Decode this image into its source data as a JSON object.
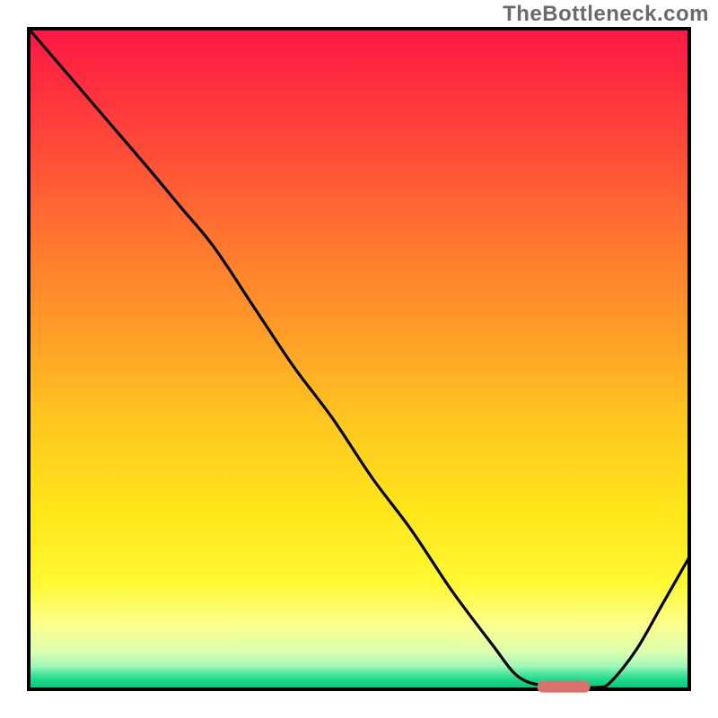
{
  "watermark": "TheBottleneck.com",
  "chart_data": {
    "type": "line",
    "title": "",
    "xlabel": "",
    "ylabel": "",
    "xlim": [
      0,
      100
    ],
    "ylim": [
      0,
      100
    ],
    "background": {
      "gradient_stops": [
        {
          "offset": 0.0,
          "color": "#ff1744"
        },
        {
          "offset": 0.07,
          "color": "#ff2a3f"
        },
        {
          "offset": 0.18,
          "color": "#ff4a38"
        },
        {
          "offset": 0.3,
          "color": "#ff7030"
        },
        {
          "offset": 0.45,
          "color": "#ff9a28"
        },
        {
          "offset": 0.6,
          "color": "#ffc81f"
        },
        {
          "offset": 0.73,
          "color": "#ffe61a"
        },
        {
          "offset": 0.84,
          "color": "#fff833"
        },
        {
          "offset": 0.9,
          "color": "#fdff8a"
        },
        {
          "offset": 0.945,
          "color": "#d8ffb0"
        },
        {
          "offset": 0.965,
          "color": "#a0f7b8"
        },
        {
          "offset": 0.975,
          "color": "#58e8a0"
        },
        {
          "offset": 0.985,
          "color": "#20d98a"
        },
        {
          "offset": 1.0,
          "color": "#00c776"
        }
      ]
    },
    "series": [
      {
        "name": "bottleneck-curve",
        "type": "line",
        "x": [
          0,
          6,
          12,
          18,
          23,
          28,
          34,
          40,
          46,
          52,
          58,
          64,
          70,
          74,
          78,
          82,
          86,
          88,
          92,
          96,
          100
        ],
        "y": [
          100,
          93,
          86,
          79,
          73,
          67,
          58,
          49,
          41,
          32,
          24,
          15,
          7,
          2,
          0.5,
          0.3,
          0.3,
          1,
          6,
          13,
          20
        ]
      }
    ],
    "marker": {
      "name": "optimal-zone",
      "x_start": 77,
      "x_end": 85,
      "y": 0.4,
      "color": "#d9726a"
    },
    "frame": {
      "stroke": "#000000",
      "stroke_width": 4
    }
  }
}
